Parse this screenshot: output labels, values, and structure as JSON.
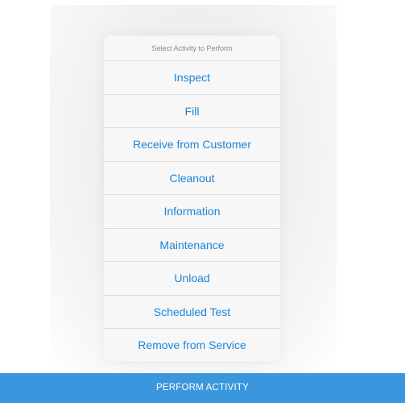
{
  "activity_sheet": {
    "title": "Select Activity to Perform",
    "items": [
      {
        "label": "Inspect"
      },
      {
        "label": "Fill"
      },
      {
        "label": "Receive from Customer"
      },
      {
        "label": "Cleanout"
      },
      {
        "label": "Information"
      },
      {
        "label": "Maintenance"
      },
      {
        "label": "Unload"
      },
      {
        "label": "Scheduled Test"
      },
      {
        "label": "Remove from Service"
      }
    ]
  },
  "footer": {
    "primary_button_label": "PERFORM ACTIVITY"
  },
  "colors": {
    "action_text": "#1c84d8",
    "primary_bar": "#3a96dd"
  }
}
